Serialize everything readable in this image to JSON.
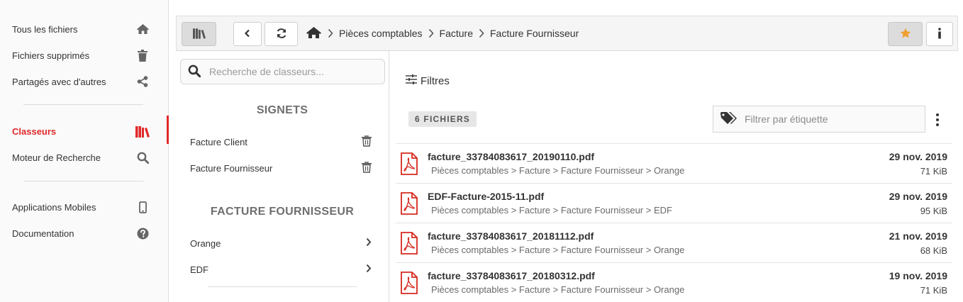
{
  "nav": {
    "items": [
      {
        "label": "Tous les fichiers",
        "icon": "home-icon"
      },
      {
        "label": "Fichiers supprimés",
        "icon": "trash-icon"
      },
      {
        "label": "Partagés avec d'autres",
        "icon": "share-icon"
      },
      {
        "label": "Classeurs",
        "icon": "books-icon",
        "active": true
      },
      {
        "label": "Moteur de Recherche",
        "icon": "search-icon"
      },
      {
        "label": "Applications Mobiles",
        "icon": "mobile-icon"
      },
      {
        "label": "Documentation",
        "icon": "question-circle-icon"
      }
    ]
  },
  "toolbar": {
    "breadcrumb": [
      "Pièces comptables",
      "Facture",
      "Facture Fournisseur"
    ]
  },
  "panel": {
    "search_placeholder": "Recherche de classeurs...",
    "bookmarks_title": "SIGNETS",
    "bookmarks": [
      "Facture Client",
      "Facture Fournisseur"
    ],
    "folder_title": "FACTURE FOURNISSEUR",
    "folders": [
      "Orange",
      "EDF"
    ]
  },
  "content": {
    "filters_label": "Filtres",
    "count_label": "6 FICHIERS",
    "tag_placeholder": "Filtrer par étiquette",
    "files": [
      {
        "name": "facture_33784083617_20190110.pdf",
        "path": "Pièces comptables > Facture > Facture Fournisseur > Orange",
        "date": "29 nov. 2019",
        "size": "71 KiB"
      },
      {
        "name": "EDF-Facture-2015-11.pdf",
        "path": "Pièces comptables > Facture > Facture Fournisseur > EDF",
        "date": "29 nov. 2019",
        "size": "95 KiB"
      },
      {
        "name": "facture_33784083617_20181112.pdf",
        "path": "Pièces comptables > Facture > Facture Fournisseur > Orange",
        "date": "21 nov. 2019",
        "size": "68 KiB"
      },
      {
        "name": "facture_33784083617_20180312.pdf",
        "path": "Pièces comptables > Facture > Facture Fournisseur > Orange",
        "date": "19 nov. 2019",
        "size": "71 KiB"
      }
    ]
  },
  "colors": {
    "accent": "#e02929",
    "pdf": "#d62a1e"
  }
}
